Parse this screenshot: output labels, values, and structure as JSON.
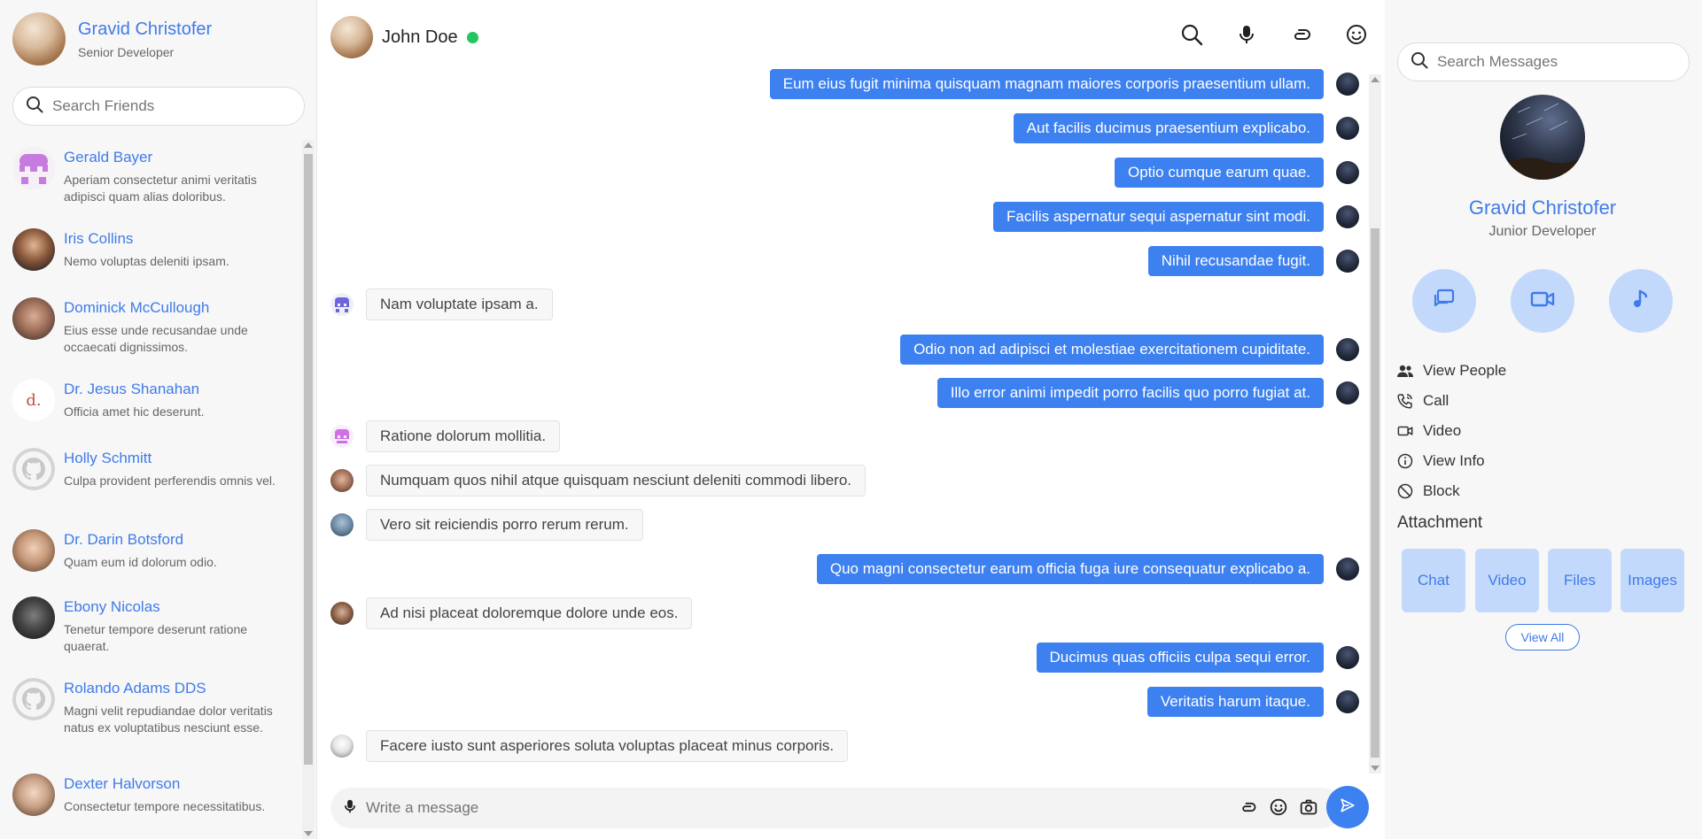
{
  "current_user": {
    "name": "Gravid Christofer",
    "role": "Senior Developer"
  },
  "search_friends": {
    "placeholder": "Search Friends"
  },
  "friends": [
    {
      "name": "Gerald Bayer",
      "message": "Aperiam consectetur animi veritatis adipisci quam alias doloribus."
    },
    {
      "name": "Iris Collins",
      "message": "Nemo voluptas deleniti ipsam."
    },
    {
      "name": "Dominick McCullough",
      "message": "Eius esse unde recusandae unde occaecati dignissimos."
    },
    {
      "name": "Dr. Jesus Shanahan",
      "message": "Officia amet hic deserunt."
    },
    {
      "name": "Holly Schmitt",
      "message": "Culpa provident perferendis omnis vel."
    },
    {
      "name": "Dr. Darin Botsford",
      "message": "Quam eum id dolorum odio."
    },
    {
      "name": "Ebony Nicolas",
      "message": "Tenetur tempore deserunt ratione quaerat."
    },
    {
      "name": "Rolando Adams DDS",
      "message": "Magni velit repudiandae dolor veritatis natus ex voluptatibus nesciunt esse."
    },
    {
      "name": "Dexter Halvorson",
      "message": "Consectetur tempore necessitatibus."
    }
  ],
  "chat": {
    "contact_name": "John Doe",
    "status": "online",
    "messages": [
      {
        "dir": "out",
        "text": "Eum eius fugit minima quisquam magnam maiores corporis praesentium ullam."
      },
      {
        "dir": "out",
        "text": "Aut facilis ducimus praesentium explicabo."
      },
      {
        "dir": "out",
        "text": "Optio cumque earum quae."
      },
      {
        "dir": "out",
        "text": "Facilis aspernatur sequi aspernatur sint modi."
      },
      {
        "dir": "out",
        "text": "Nihil recusandae fugit."
      },
      {
        "dir": "in",
        "text": "Nam voluptate ipsam a."
      },
      {
        "dir": "out",
        "text": "Odio non ad adipisci et molestiae exercitationem cupiditate."
      },
      {
        "dir": "out",
        "text": "Illo error animi impedit porro facilis quo porro fugiat at."
      },
      {
        "dir": "in",
        "text": "Ratione dolorum mollitia."
      },
      {
        "dir": "in",
        "text": "Numquam quos nihil atque quisquam nesciunt deleniti commodi libero."
      },
      {
        "dir": "in",
        "text": "Vero sit reiciendis porro rerum rerum."
      },
      {
        "dir": "out",
        "text": "Quo magni consectetur earum officia fuga iure consequatur explicabo a."
      },
      {
        "dir": "in",
        "text": "Ad nisi placeat doloremque dolore unde eos."
      },
      {
        "dir": "out",
        "text": "Ducimus quas officiis culpa sequi error."
      },
      {
        "dir": "out",
        "text": "Veritatis harum itaque."
      },
      {
        "dir": "in",
        "text": "Facere iusto sunt asperiores soluta voluptas placeat minus corporis."
      }
    ],
    "composer_placeholder": "Write a message"
  },
  "right_panel": {
    "search_placeholder": "Search Messages",
    "profile_name": "Gravid Christofer",
    "profile_role": "Junior Developer",
    "menu": [
      {
        "label": "View People",
        "icon": "people-icon"
      },
      {
        "label": "Call",
        "icon": "phone-icon"
      },
      {
        "label": "Video",
        "icon": "video-icon"
      },
      {
        "label": "View Info",
        "icon": "info-icon"
      },
      {
        "label": "Block",
        "icon": "block-icon"
      }
    ],
    "attachment_title": "Attachment",
    "attachments": [
      "Chat",
      "Video",
      "Files",
      "Images"
    ],
    "view_all": "View All"
  },
  "colors": {
    "accent": "#3d80f0",
    "link": "#3f7be8",
    "online": "#22c55e",
    "soft_blue": "#c3d9fc"
  }
}
